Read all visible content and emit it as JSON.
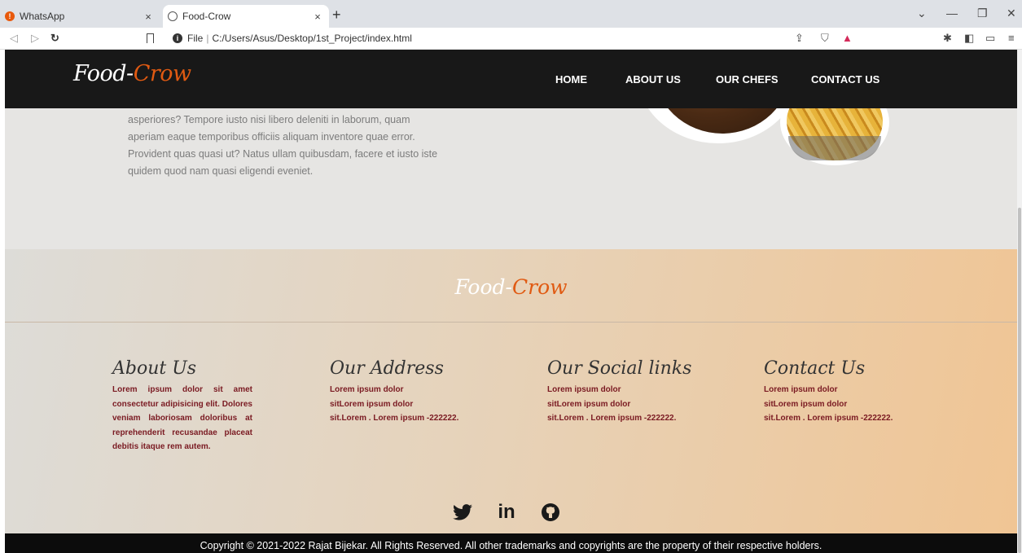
{
  "browser": {
    "tabs": [
      {
        "title": "WhatsApp",
        "close": "×"
      },
      {
        "title": "Food-Crow",
        "close": "×"
      }
    ],
    "new_tab": "+",
    "address": {
      "scheme": "File",
      "path": "C:/Users/Asus/Desktop/1st_Project/index.html"
    },
    "window": {
      "minimize": "—",
      "maximize": "❐",
      "close": "✕",
      "dropdown": "⌄"
    }
  },
  "navbar": {
    "brand_part1": "Food-",
    "brand_part2": "Crow",
    "menu": [
      "HOME",
      "ABOUT US",
      "OUR CHEFS",
      "CONTACT US"
    ]
  },
  "hero": {
    "text": "asperiores? Tempore iusto nisi libero deleniti in laborum, quam aperiam eaque temporibus officiis aliquam inventore quae error. Provident quas quasi ut? Natus ullam quibusdam, facere et iusto iste quidem quod nam quasi eligendi eveniet."
  },
  "footer": {
    "brand_part1": "Food-",
    "brand_part2": "Crow",
    "columns": [
      {
        "title": "About Us",
        "text": "Lorem ipsum dolor sit amet consectetur adipisicing elit. Dolores veniam laboriosam doloribus at reprehenderit recusandae placeat debitis itaque rem autem."
      },
      {
        "title": "Our Address",
        "lines": [
          "Lorem ipsum dolor",
          "sitLorem ipsum dolor",
          "sit.Lorem . Lorem ipsum -222222."
        ]
      },
      {
        "title": "Our Social links",
        "lines": [
          "Lorem ipsum dolor",
          "sitLorem ipsum dolor",
          "sit.Lorem . Lorem ipsum -222222."
        ]
      },
      {
        "title": "Contact Us",
        "lines": [
          "Lorem ipsum dolor",
          "sitLorem ipsum dolor",
          "sit.Lorem . Lorem ipsum -222222."
        ]
      }
    ],
    "social_icons": [
      "twitter-icon",
      "linkedin-icon",
      "github-icon"
    ],
    "linkedin_glyph": "in",
    "copyright": "Copyright © 2021-2022 Rajat Bijekar. All Rights Reserved. All other trademarks and copyrights are the property of their respective holders."
  },
  "colors": {
    "accent": "#e05a12",
    "navbar": "#181818",
    "footer_text": "#7a1a22"
  }
}
